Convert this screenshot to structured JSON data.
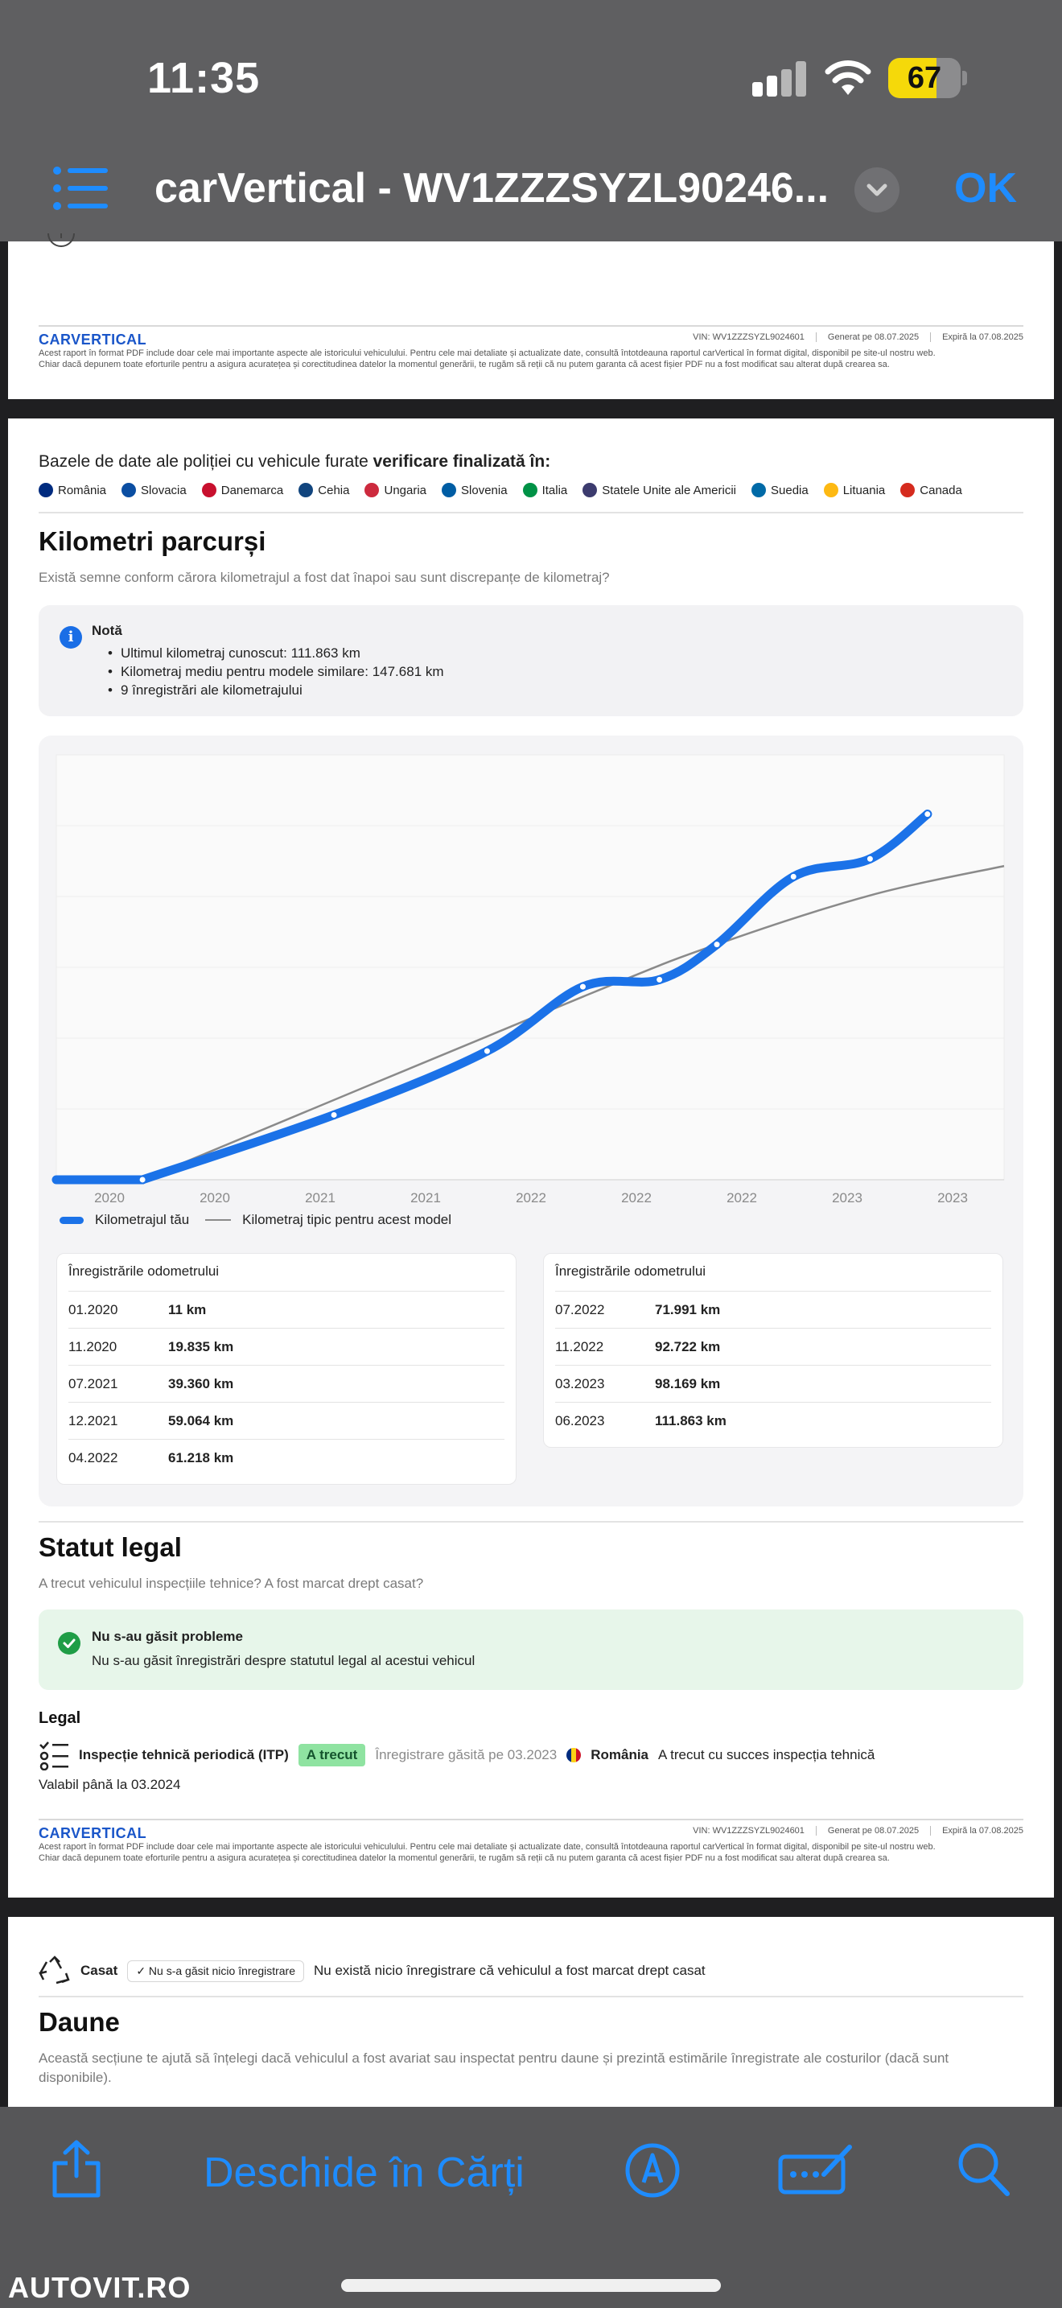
{
  "status_bar": {
    "time": "11:35",
    "battery": "67"
  },
  "header": {
    "title": "carVertical - WV1ZZZSYZL90246...",
    "ok": "OK"
  },
  "report_footer": {
    "logo": "CARVERTICAL",
    "vin": "VIN: WV1ZZZSYZL9024601",
    "generated": "Generat pe 08.07.2025",
    "expires": "Expiră la 07.08.2025",
    "disclaimer_1": "Acest raport în format PDF include doar cele mai importante aspecte ale istoricului vehiculului. Pentru cele mai detaliate și actualizate date, consultă întotdeauna raportul carVertical în format digital, disponibil pe site-ul nostru web.",
    "disclaimer_2": "Chiar dacă depunem toate eforturile pentru a asigura acuratețea și corectitudinea datelor la momentul generării, te rugăm să reții că nu putem garanta că acest fișier PDF nu a fost modificat sau alterat după crearea sa."
  },
  "stolen_db": {
    "title_prefix": "Bazele de date ale poliției cu vehicule furate ",
    "title_bold": "verificare finalizată în:",
    "countries": [
      {
        "name": "România",
        "color": "#002b7f"
      },
      {
        "name": "Slovacia",
        "color": "#0b4ea2"
      },
      {
        "name": "Danemarca",
        "color": "#c8102e"
      },
      {
        "name": "Cehia",
        "color": "#11457e"
      },
      {
        "name": "Ungaria",
        "color": "#cd2a3e"
      },
      {
        "name": "Slovenia",
        "color": "#005da4"
      },
      {
        "name": "Italia",
        "color": "#009246"
      },
      {
        "name": "Statele Unite ale Americii",
        "color": "#3c3b6e"
      },
      {
        "name": "Suedia",
        "color": "#006aa7"
      },
      {
        "name": "Lituania",
        "color": "#fdb913"
      },
      {
        "name": "Canada",
        "color": "#d52b1e"
      }
    ]
  },
  "mileage": {
    "title": "Kilometri parcurși",
    "subtitle": "Există semne conform cărora kilometrajul a fost dat înapoi sau sunt discrepanțe de kilometraj?",
    "note_title": "Notă",
    "note_items": [
      "Ultimul kilometraj cunoscut: 111.863 km",
      "Kilometraj mediu pentru modele similare: 147.681 km",
      "9 înregistrări ale kilometrajului"
    ],
    "legend_yours": "Kilometrajul tău",
    "legend_typical": "Kilometraj tipic pentru acest model",
    "table_header": "Înregistrările odometrului",
    "table_left": [
      {
        "date": "01.2020",
        "value": "11 km"
      },
      {
        "date": "11.2020",
        "value": "19.835 km"
      },
      {
        "date": "07.2021",
        "value": "39.360 km"
      },
      {
        "date": "12.2021",
        "value": "59.064 km"
      },
      {
        "date": "04.2022",
        "value": "61.218 km"
      }
    ],
    "table_right": [
      {
        "date": "07.2022",
        "value": "71.991 km"
      },
      {
        "date": "11.2022",
        "value": "92.722 km"
      },
      {
        "date": "03.2023",
        "value": "98.169 km"
      },
      {
        "date": "06.2023",
        "value": "111.863 km"
      }
    ]
  },
  "chart_data": {
    "type": "line",
    "x_tick_labels": [
      "2020",
      "2020",
      "2021",
      "2021",
      "2022",
      "2022",
      "2022",
      "2023",
      "2023"
    ],
    "series": [
      {
        "name": "Kilometrajul tău",
        "color": "#1b72e8",
        "points": [
          {
            "date": "01.2020",
            "km": 11
          },
          {
            "date": "11.2020",
            "km": 19835
          },
          {
            "date": "07.2021",
            "km": 39360
          },
          {
            "date": "12.2021",
            "km": 59064
          },
          {
            "date": "04.2022",
            "km": 61218
          },
          {
            "date": "07.2022",
            "km": 71991
          },
          {
            "date": "11.2022",
            "km": 92722
          },
          {
            "date": "03.2023",
            "km": 98169
          },
          {
            "date": "06.2023",
            "km": 111863
          }
        ]
      },
      {
        "name": "Kilometraj tipic pentru acest model",
        "color": "#8a8a8a",
        "points": [
          {
            "date": "01.2020",
            "km": 0
          },
          {
            "date": "12.2021",
            "km": 56000
          },
          {
            "date": "07.2022",
            "km": 72000
          },
          {
            "date": "03.2023",
            "km": 87000
          },
          {
            "date": "10.2023",
            "km": 96000
          }
        ]
      }
    ],
    "ylim": [
      0,
      130000
    ],
    "grid": true
  },
  "legal": {
    "title": "Statut legal",
    "subtitle": "A trecut vehiculul inspecțiile tehnice? A fost marcat drept casat?",
    "ok_title": "Nu s-au găsit probleme",
    "ok_text": "Nu s-au găsit înregistrări despre statutul legal al acestui vehicul",
    "section": "Legal",
    "itp_label": "Inspecție tehnică periodică (ITP)",
    "itp_badge": "A trecut",
    "itp_record": "Înregistrare găsită pe 03.2023",
    "itp_country": "România",
    "itp_result": "A trecut cu succes inspecția tehnică",
    "valid_until": "Valabil până la 03.2024"
  },
  "scrapped": {
    "label": "Casat",
    "chip": "✓ Nu s-a găsit nicio înregistrare",
    "text": "Nu există nicio înregistrare că vehiculul a fost marcat drept casat"
  },
  "damage": {
    "title": "Daune",
    "subtitle": "Această secțiune te ajută să înțelegi dacă vehiculul a fost avariat sau inspectat pentru daune și prezintă estimările înregistrate ale costurilor (dacă sunt disponibile)."
  },
  "toolbar": {
    "open_books": "Deschide în Cărți"
  },
  "watermark": "AUTOVIT.RO"
}
